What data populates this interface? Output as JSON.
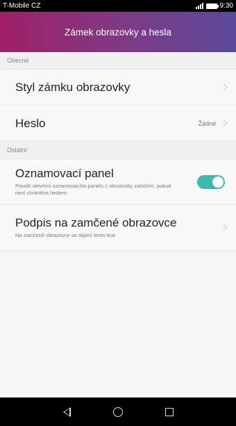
{
  "status_bar": {
    "carrier": "T-Mobile CZ",
    "time": "9:30"
  },
  "app_bar": {
    "title": "Zámek obrazovky a hesla"
  },
  "sections": [
    {
      "header": "Obecné",
      "rows": [
        {
          "title": "Styl zámku obrazovky",
          "value": ""
        },
        {
          "title": "Heslo",
          "value": "Žádné"
        }
      ]
    },
    {
      "header": "Ostatní",
      "rows": [
        {
          "title": "Oznamovací panel",
          "subtitle": "Povolit otevření oznamovacího panelu z obrazovky zamčení, pokud není chráněna heslem",
          "toggle": true
        },
        {
          "title": "Podpis na zamčené obrazovce",
          "subtitle": "Na zamčené obrazovce se objeví tento text"
        }
      ]
    }
  ],
  "colors": {
    "appbar_gradient_start": "#a02066",
    "appbar_gradient_end": "#5a4a99",
    "toggle_on": "#3fb9b0"
  },
  "icons": [
    "signal-icon",
    "battery-icon",
    "chevron-right-icon",
    "nav-back-icon",
    "nav-home-icon",
    "nav-recent-icon"
  ]
}
